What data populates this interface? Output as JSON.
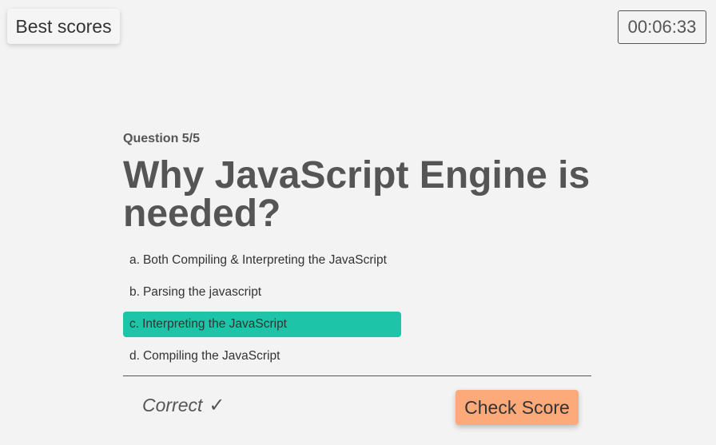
{
  "header": {
    "best_scores_label": "Best scores",
    "timer": "00:06:33"
  },
  "quiz": {
    "question_counter": "Question 5/5",
    "question": "Why JavaScript Engine is needed?",
    "options": [
      {
        "prefix": "a.",
        "text": "Both Compiling & Interpreting the JavaScript",
        "selected": false
      },
      {
        "prefix": "b.",
        "text": "Parsing the javascript",
        "selected": false
      },
      {
        "prefix": "c.",
        "text": "Interpreting the JavaScript",
        "selected": true
      },
      {
        "prefix": "d.",
        "text": "Compiling the JavaScript",
        "selected": false
      }
    ],
    "result_text": "Correct",
    "result_symbol": "✓",
    "check_score_label": "Check Score"
  },
  "colors": {
    "background": "#f3f3f3",
    "text": "#555555",
    "selected_option": "#1dc4a8",
    "check_score_button": "#fdaa7b"
  }
}
